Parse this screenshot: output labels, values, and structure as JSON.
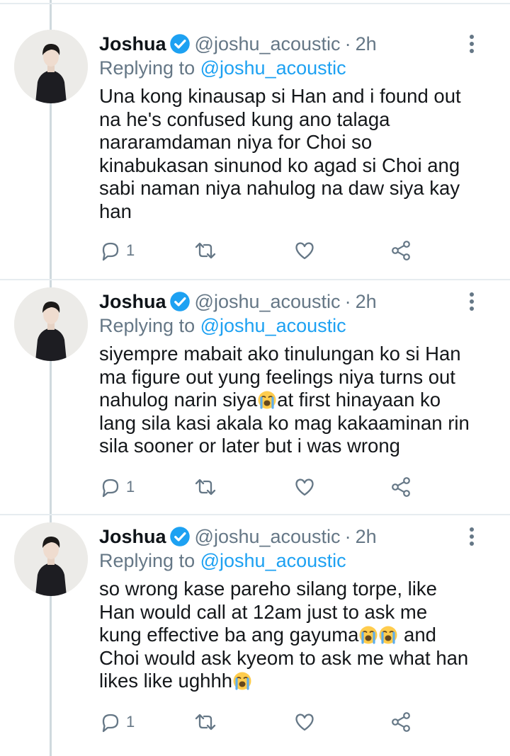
{
  "tweets": [
    {
      "name": "Joshua",
      "handle": "@joshu_acoustic",
      "separator": "·",
      "time": "2h",
      "replying_label": "Replying to",
      "replying_handle": "@joshu_acoustic",
      "lines": [
        "Una kong kinausap si Han and i found out",
        "na he's confused kung ano talaga",
        "nararamdaman niya for Choi so",
        "kinabukasan sinunod ko agad si Choi ang",
        "sabi naman niya nahulog na daw siya kay",
        "han"
      ],
      "reply_count": "1"
    },
    {
      "name": "Joshua",
      "handle": "@joshu_acoustic",
      "separator": "·",
      "time": "2h",
      "replying_label": "Replying to",
      "replying_handle": "@joshu_acoustic",
      "lines": [
        "siyempre mabait ako tinulungan ko si Han",
        "ma figure out yung feelings niya turns out",
        "nahulog narin siya",
        "at first hinayaan ko",
        "lang sila kasi akala ko mag kakaaminan rin",
        "sila sooner or later but i was wrong"
      ],
      "reply_count": "1"
    },
    {
      "name": "Joshua",
      "handle": "@joshu_acoustic",
      "separator": "·",
      "time": "2h",
      "replying_label": "Replying to",
      "replying_handle": "@joshu_acoustic",
      "lines": [
        "so wrong kase pareho silang torpe, like",
        "Han would call at 12am just to ask me",
        "kung effective ba ang gayuma",
        " and",
        "Choi would ask kyeom to ask me what han",
        "likes like ughhh"
      ],
      "reply_count": "1"
    }
  ],
  "icons": {
    "verified": "verified-badge-icon",
    "more": "more-vertical-icon",
    "reply": "reply-bubble-icon",
    "retweet": "retweet-icon",
    "like": "heart-icon",
    "share": "share-icon",
    "emoji": "loudly-crying-face-emoji"
  },
  "colors": {
    "link": "#1da1f2",
    "secondary_text": "#657786",
    "verified": "#1da1f2"
  }
}
